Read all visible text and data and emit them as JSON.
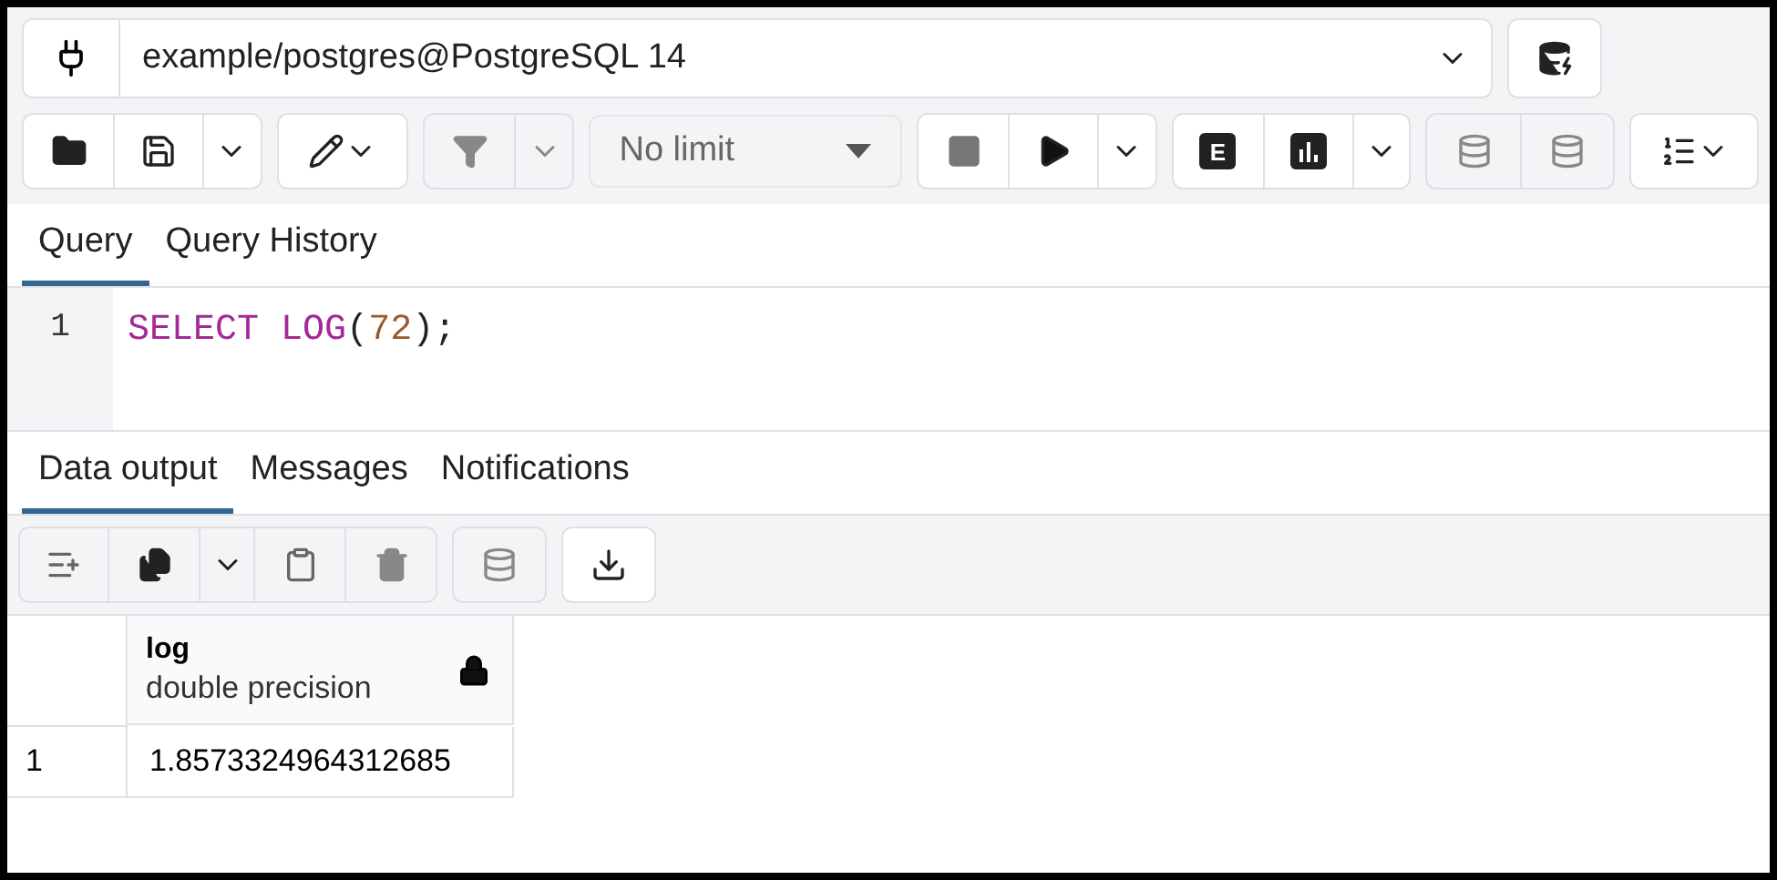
{
  "connection": {
    "value": "example/postgres@PostgreSQL 14"
  },
  "toolbar": {
    "limit": {
      "value": "No limit"
    },
    "explain_label": "E"
  },
  "query_tabs": [
    {
      "label": "Query",
      "selected": true
    },
    {
      "label": "Query History",
      "selected": false
    }
  ],
  "editor": {
    "lines": [
      {
        "number": "1",
        "tokens": [
          {
            "text": "SELECT",
            "kind": "keyword"
          },
          {
            "text": "LOG",
            "kind": "keyword"
          },
          {
            "text": "(",
            "kind": "punct"
          },
          {
            "text": "72",
            "kind": "number"
          },
          {
            "text": ");",
            "kind": "punct"
          }
        ]
      }
    ]
  },
  "output_tabs": [
    {
      "label": "Data output",
      "selected": true
    },
    {
      "label": "Messages",
      "selected": false
    },
    {
      "label": "Notifications",
      "selected": false
    }
  ],
  "table": {
    "columns": [
      {
        "name": "log",
        "type": "double precision",
        "locked": true
      }
    ],
    "rows": [
      {
        "number": "1",
        "cells": [
          "1.8573324964312685"
        ]
      }
    ]
  }
}
